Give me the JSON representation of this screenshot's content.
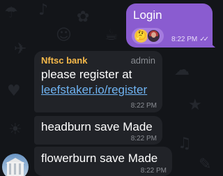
{
  "outgoing": {
    "text": "Login",
    "reaction_emoji": "🤔",
    "time": "8:22 PM",
    "status_icon": "double-check-icon",
    "status_glyph": "✓✓"
  },
  "messages": [
    {
      "sender": "Nftsc bank",
      "role": "admin",
      "text_before": "please register at",
      "link": "leefstaker.io/register",
      "time": "8:22 PM"
    },
    {
      "text": "headburn save Made",
      "time": "8:22 PM"
    },
    {
      "text": "flowerburn save Made",
      "time": "8:22 PM"
    }
  ],
  "colors": {
    "outgoing_bubble": "#8a5cd0",
    "incoming_bubble": "#212328",
    "sender_name": "#f6b94a",
    "link": "#6fb3f2",
    "background": "#131519"
  }
}
